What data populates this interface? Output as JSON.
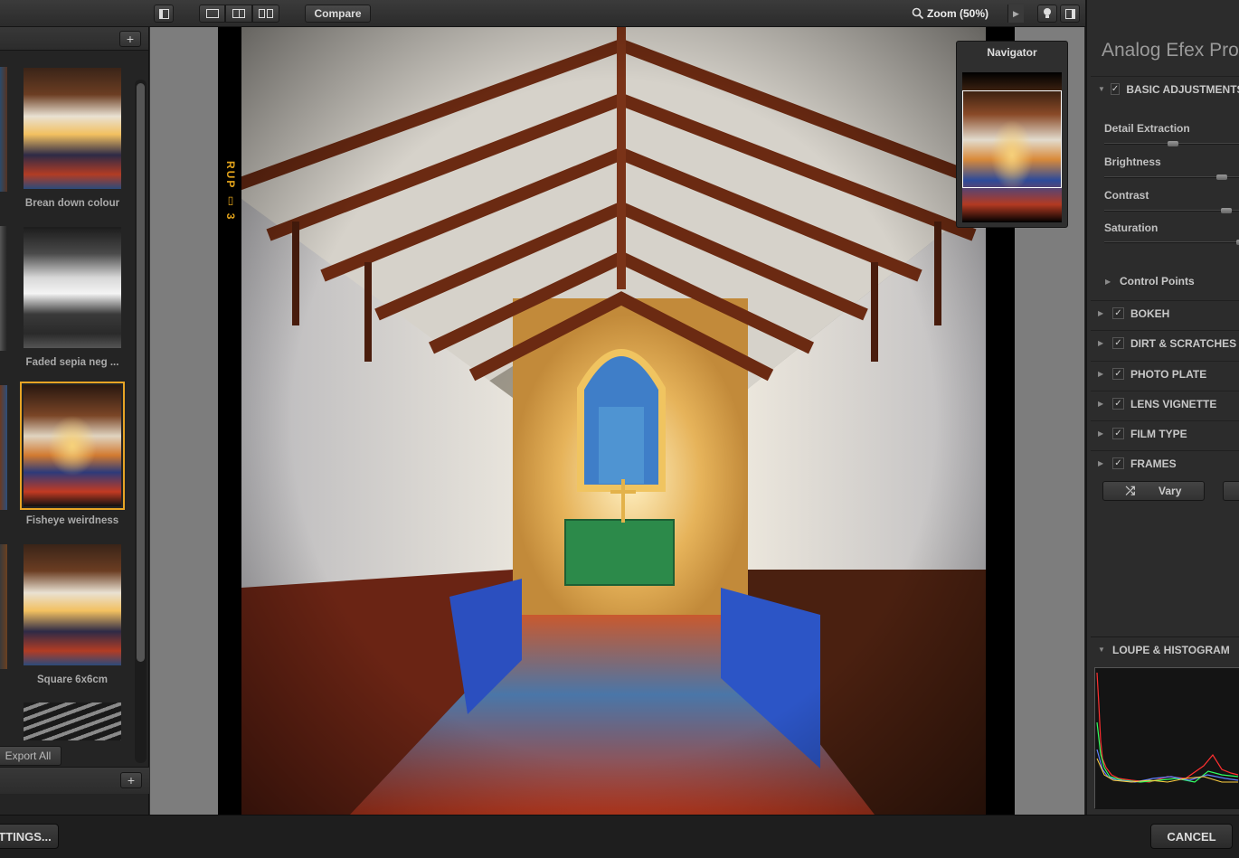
{
  "toolbar": {
    "compare_label": "Compare",
    "zoom_label": "Zoom (50%)"
  },
  "presets": [
    {
      "label": "Brean down colour",
      "selected": false
    },
    {
      "label": "Faded sepia neg ...",
      "selected": false
    },
    {
      "label": "Fisheye weirdness",
      "selected": true
    },
    {
      "label": "Square 6x6cm",
      "selected": false
    }
  ],
  "left_panel": {
    "export_label": "Export All"
  },
  "film_marking": "RUP ▯ 3",
  "navigator": {
    "title": "Navigator"
  },
  "right_panel": {
    "title": "Analog Efex Pro",
    "basic_adjustments": "BASIC ADJUSTMENTS",
    "sliders": [
      {
        "label": "Detail Extraction",
        "value": 0.5
      },
      {
        "label": "Brightness",
        "value": 0.85
      },
      {
        "label": "Contrast",
        "value": 0.9
      },
      {
        "label": "Saturation",
        "value": 1.0
      }
    ],
    "control_points": "Control Points",
    "sections": [
      "BOKEH",
      "DIRT & SCRATCHES",
      "PHOTO PLATE",
      "LENS VIGNETTE",
      "FILM TYPE",
      "FRAMES"
    ],
    "vary_label": "Vary",
    "loupe_label": "LOUPE & HISTOGRAM"
  },
  "bottom": {
    "settings_label": "TTINGS...",
    "cancel_label": "CANCEL"
  },
  "colors": {
    "selection": "#e7a425",
    "film_mark": "#e1a21b"
  }
}
